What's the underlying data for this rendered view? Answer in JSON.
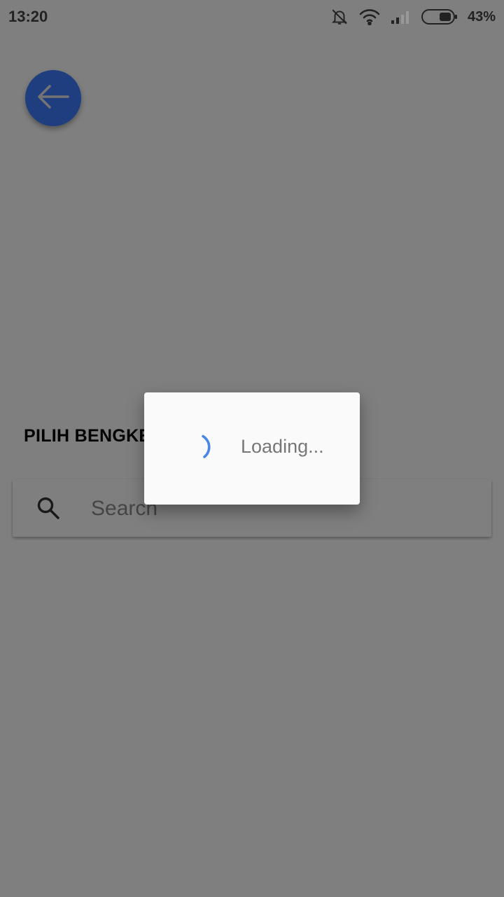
{
  "status_bar": {
    "time": "13:20",
    "battery": "43%",
    "icons": [
      "notifications-off-icon",
      "wifi-icon",
      "signal-icon",
      "battery-icon"
    ]
  },
  "back_button": {
    "icon": "arrow-left-icon",
    "color": "#3d7cff"
  },
  "sheet": {
    "title": "PILIH BENGKEL",
    "search": {
      "placeholder": "Search",
      "value": "",
      "icon": "search-icon"
    }
  },
  "dialog": {
    "message": "Loading...",
    "spinner_color": "#4a86e8"
  },
  "colors": {
    "accent": "#3d7cff",
    "scrim": "rgba(0,0,0,0.5)"
  }
}
